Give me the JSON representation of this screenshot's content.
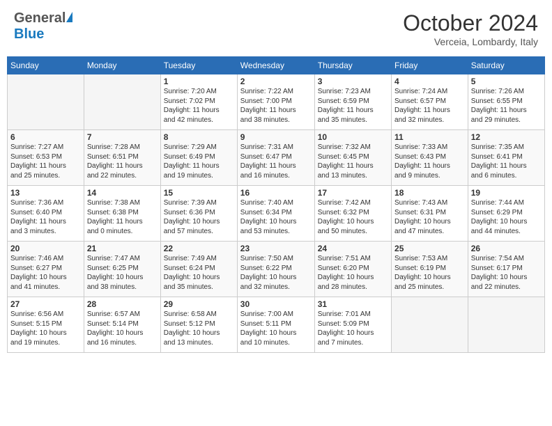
{
  "header": {
    "logo_general": "General",
    "logo_blue": "Blue",
    "month_title": "October 2024",
    "location": "Verceia, Lombardy, Italy"
  },
  "weekdays": [
    "Sunday",
    "Monday",
    "Tuesday",
    "Wednesday",
    "Thursday",
    "Friday",
    "Saturday"
  ],
  "weeks": [
    [
      {
        "day": "",
        "detail": ""
      },
      {
        "day": "",
        "detail": ""
      },
      {
        "day": "1",
        "detail": "Sunrise: 7:20 AM\nSunset: 7:02 PM\nDaylight: 11 hours\nand 42 minutes."
      },
      {
        "day": "2",
        "detail": "Sunrise: 7:22 AM\nSunset: 7:00 PM\nDaylight: 11 hours\nand 38 minutes."
      },
      {
        "day": "3",
        "detail": "Sunrise: 7:23 AM\nSunset: 6:59 PM\nDaylight: 11 hours\nand 35 minutes."
      },
      {
        "day": "4",
        "detail": "Sunrise: 7:24 AM\nSunset: 6:57 PM\nDaylight: 11 hours\nand 32 minutes."
      },
      {
        "day": "5",
        "detail": "Sunrise: 7:26 AM\nSunset: 6:55 PM\nDaylight: 11 hours\nand 29 minutes."
      }
    ],
    [
      {
        "day": "6",
        "detail": "Sunrise: 7:27 AM\nSunset: 6:53 PM\nDaylight: 11 hours\nand 25 minutes."
      },
      {
        "day": "7",
        "detail": "Sunrise: 7:28 AM\nSunset: 6:51 PM\nDaylight: 11 hours\nand 22 minutes."
      },
      {
        "day": "8",
        "detail": "Sunrise: 7:29 AM\nSunset: 6:49 PM\nDaylight: 11 hours\nand 19 minutes."
      },
      {
        "day": "9",
        "detail": "Sunrise: 7:31 AM\nSunset: 6:47 PM\nDaylight: 11 hours\nand 16 minutes."
      },
      {
        "day": "10",
        "detail": "Sunrise: 7:32 AM\nSunset: 6:45 PM\nDaylight: 11 hours\nand 13 minutes."
      },
      {
        "day": "11",
        "detail": "Sunrise: 7:33 AM\nSunset: 6:43 PM\nDaylight: 11 hours\nand 9 minutes."
      },
      {
        "day": "12",
        "detail": "Sunrise: 7:35 AM\nSunset: 6:41 PM\nDaylight: 11 hours\nand 6 minutes."
      }
    ],
    [
      {
        "day": "13",
        "detail": "Sunrise: 7:36 AM\nSunset: 6:40 PM\nDaylight: 11 hours\nand 3 minutes."
      },
      {
        "day": "14",
        "detail": "Sunrise: 7:38 AM\nSunset: 6:38 PM\nDaylight: 11 hours\nand 0 minutes."
      },
      {
        "day": "15",
        "detail": "Sunrise: 7:39 AM\nSunset: 6:36 PM\nDaylight: 10 hours\nand 57 minutes."
      },
      {
        "day": "16",
        "detail": "Sunrise: 7:40 AM\nSunset: 6:34 PM\nDaylight: 10 hours\nand 53 minutes."
      },
      {
        "day": "17",
        "detail": "Sunrise: 7:42 AM\nSunset: 6:32 PM\nDaylight: 10 hours\nand 50 minutes."
      },
      {
        "day": "18",
        "detail": "Sunrise: 7:43 AM\nSunset: 6:31 PM\nDaylight: 10 hours\nand 47 minutes."
      },
      {
        "day": "19",
        "detail": "Sunrise: 7:44 AM\nSunset: 6:29 PM\nDaylight: 10 hours\nand 44 minutes."
      }
    ],
    [
      {
        "day": "20",
        "detail": "Sunrise: 7:46 AM\nSunset: 6:27 PM\nDaylight: 10 hours\nand 41 minutes."
      },
      {
        "day": "21",
        "detail": "Sunrise: 7:47 AM\nSunset: 6:25 PM\nDaylight: 10 hours\nand 38 minutes."
      },
      {
        "day": "22",
        "detail": "Sunrise: 7:49 AM\nSunset: 6:24 PM\nDaylight: 10 hours\nand 35 minutes."
      },
      {
        "day": "23",
        "detail": "Sunrise: 7:50 AM\nSunset: 6:22 PM\nDaylight: 10 hours\nand 32 minutes."
      },
      {
        "day": "24",
        "detail": "Sunrise: 7:51 AM\nSunset: 6:20 PM\nDaylight: 10 hours\nand 28 minutes."
      },
      {
        "day": "25",
        "detail": "Sunrise: 7:53 AM\nSunset: 6:19 PM\nDaylight: 10 hours\nand 25 minutes."
      },
      {
        "day": "26",
        "detail": "Sunrise: 7:54 AM\nSunset: 6:17 PM\nDaylight: 10 hours\nand 22 minutes."
      }
    ],
    [
      {
        "day": "27",
        "detail": "Sunrise: 6:56 AM\nSunset: 5:15 PM\nDaylight: 10 hours\nand 19 minutes."
      },
      {
        "day": "28",
        "detail": "Sunrise: 6:57 AM\nSunset: 5:14 PM\nDaylight: 10 hours\nand 16 minutes."
      },
      {
        "day": "29",
        "detail": "Sunrise: 6:58 AM\nSunset: 5:12 PM\nDaylight: 10 hours\nand 13 minutes."
      },
      {
        "day": "30",
        "detail": "Sunrise: 7:00 AM\nSunset: 5:11 PM\nDaylight: 10 hours\nand 10 minutes."
      },
      {
        "day": "31",
        "detail": "Sunrise: 7:01 AM\nSunset: 5:09 PM\nDaylight: 10 hours\nand 7 minutes."
      },
      {
        "day": "",
        "detail": ""
      },
      {
        "day": "",
        "detail": ""
      }
    ]
  ]
}
